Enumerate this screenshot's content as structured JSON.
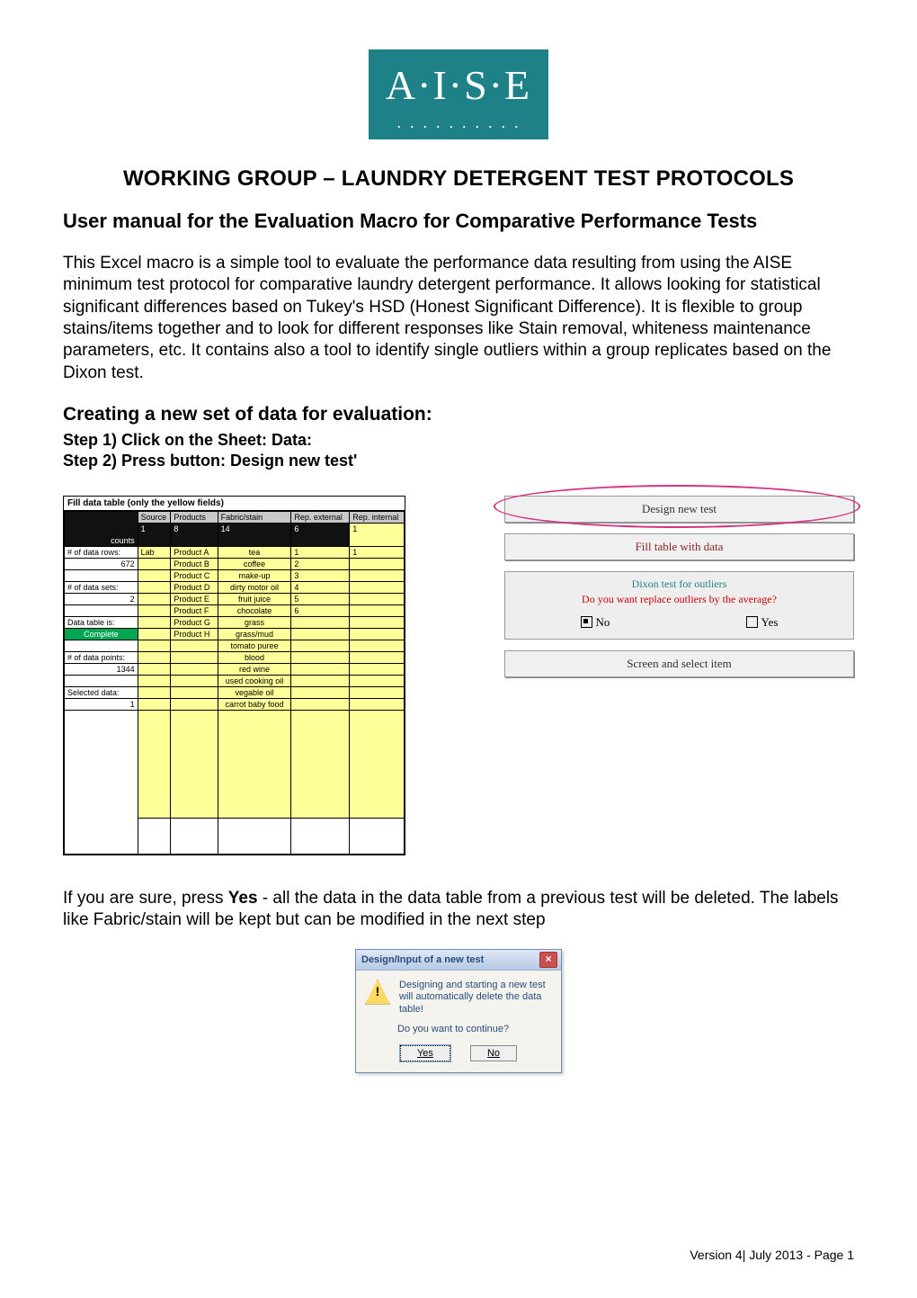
{
  "logo": {
    "text": "A·I·S·E"
  },
  "title": "WORKING GROUP – LAUNDRY DETERGENT TEST PROTOCOLS",
  "subtitle": "User manual for the Evaluation Macro for Comparative Performance Tests",
  "intro": "This Excel macro is a simple tool to evaluate the performance data resulting from using the AISE minimum test protocol for comparative laundry detergent performance. It allows looking for statistical significant differences based on Tukey's HSD (Honest Significant Difference). It is flexible to group stains/items together and to look for different responses like Stain removal, whiteness maintenance parameters, etc. It contains also a tool to identify single outliers within a group replicates based on the Dixon test.",
  "section": {
    "heading": "Creating a new set of data for evaluation:",
    "step1": "Step 1) Click on the Sheet: Data:",
    "step2": "Step 2) Press button: Design new test'"
  },
  "sheet": {
    "caption": "Fill data table (only the yellow fields)",
    "header": {
      "counts_label": "counts",
      "source": "Source",
      "products": "Products",
      "fabric": "Fabric/stain",
      "rep_ext": "Rep. external",
      "rep_int": "Rep. internal",
      "counts_src": "1",
      "counts_prod": "8",
      "counts_fabric": "14",
      "counts_ext": "6",
      "counts_int": "1"
    },
    "left": {
      "rows_label": "# of data rows:",
      "rows_value": "672",
      "sets_label": "# of data sets:",
      "sets_value": "2",
      "table_label": "Data table is:",
      "table_status": "Complete",
      "points_label": "# of data points:",
      "points_value": "1344",
      "selected_label": "Selected data:",
      "selected_value": "1"
    },
    "source": "Lab",
    "products": [
      "Product A",
      "Product B",
      "Product C",
      "Product D",
      "Product E",
      "Product F",
      "Product G",
      "Product H"
    ],
    "fabrics": [
      "tea",
      "coffee",
      "make-up",
      "dirty motor oil",
      "fruit juice",
      "chocolate",
      "grass",
      "grass/mud",
      "tomato puree",
      "blood",
      "red wine",
      "used cooking oil",
      "vegable oil",
      "carrot baby food"
    ],
    "rep_ext_vals": [
      "1",
      "2",
      "3",
      "4",
      "5",
      "6"
    ],
    "rep_int_vals": [
      "1"
    ]
  },
  "panel": {
    "design_btn": "Design new test",
    "fill_btn": "Fill table with data",
    "dixon_title": "Dixon test for outliers",
    "dixon_sub": "Do you want replace outliers by the average?",
    "no": "No",
    "yes": "Yes",
    "screen_btn": "Screen and select item"
  },
  "after": {
    "line_pre": "If you are sure, press ",
    "bold": "Yes",
    "line_post": " - all the data in the data table from a previous test will be deleted. The labels like Fabric/stain will be kept but can be modified in the next step"
  },
  "dialog": {
    "title": "Design/Input of a new test",
    "line1": "Designing and starting a new test",
    "line2": "will automatically delete the data table!",
    "question": "Do you want to continue?",
    "yes": "Yes",
    "no": "No"
  },
  "footer": "Version 4| July 2013 - Page 1"
}
